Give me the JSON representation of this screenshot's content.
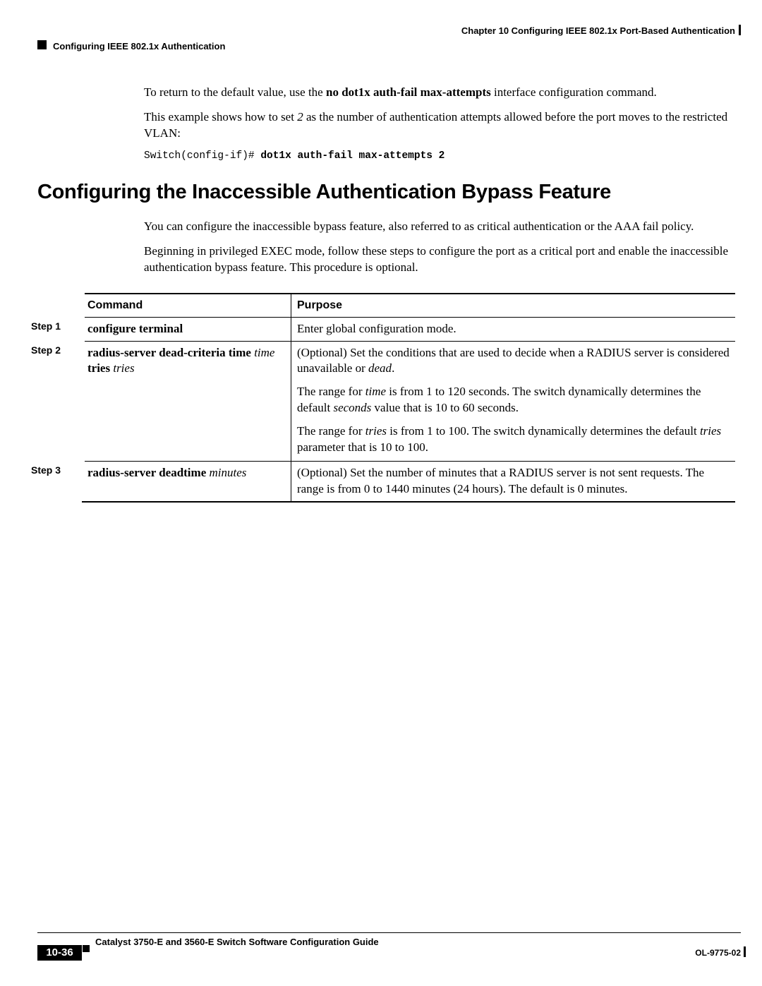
{
  "header": {
    "chapter": "Chapter 10      Configuring IEEE 802.1x Port-Based Authentication",
    "section": "Configuring IEEE 802.1x Authentication"
  },
  "intro": {
    "p1_a": "To return to the default value, use the ",
    "p1_b": "no dot1x auth-fail max-attempts",
    "p1_c": " interface configuration command.",
    "p2_a": "This example shows how to set ",
    "p2_b": "2",
    "p2_c": " as the number of authentication attempts allowed before the port moves to the restricted VLAN:",
    "code_prompt": "Switch(config-if)# ",
    "code_cmd": "dot1x auth-fail max-attempts 2"
  },
  "heading": "Configuring the Inaccessible Authentication Bypass Feature",
  "sec": {
    "p1": "You can configure the inaccessible bypass feature, also referred to as critical authentication or the AAA fail policy.",
    "p2": "Beginning in privileged EXEC mode, follow these steps to configure the port as a critical port and enable the inaccessible authentication bypass feature. This procedure is optional."
  },
  "table": {
    "h_cmd": "Command",
    "h_purpose": "Purpose",
    "r1": {
      "step": "Step 1",
      "cmd": "configure terminal",
      "purpose": "Enter global configuration mode."
    },
    "r2": {
      "step": "Step 2",
      "cmd_a": "radius-server dead-criteria time ",
      "cmd_b": "time",
      "cmd_c": "tries ",
      "cmd_d": "tries",
      "p1_a": "(Optional) Set the conditions that are used to decide when a RADIUS server is considered unavailable or ",
      "p1_b": "dead",
      "p1_c": ".",
      "p2_a": "The range for ",
      "p2_b": "time",
      "p2_c": " is from 1 to 120 seconds. The switch dynamically determines the default ",
      "p2_d": "seconds",
      "p2_e": " value that is 10 to 60 seconds.",
      "p3_a": "The range for ",
      "p3_b": "tries",
      "p3_c": " is from 1 to 100. The switch dynamically determines the default ",
      "p3_d": "tries",
      "p3_e": " parameter that is 10 to 100."
    },
    "r3": {
      "step": "Step 3",
      "cmd_a": "radius-server deadtime ",
      "cmd_b": "minutes",
      "purpose": "(Optional) Set the number of minutes that a RADIUS server is not sent requests. The range is from 0 to 1440 minutes (24 hours). The default is 0 minutes."
    }
  },
  "footer": {
    "guide": "Catalyst 3750-E and 3560-E Switch Software Configuration Guide",
    "page": "10-36",
    "doc": "OL-9775-02"
  }
}
